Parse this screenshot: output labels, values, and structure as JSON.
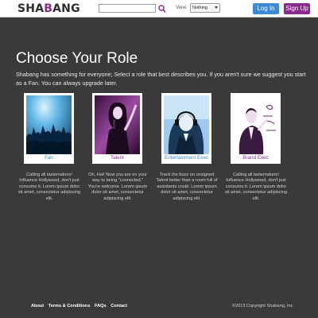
{
  "header": {
    "logo_prefix": "SHA",
    "logo_accent": "B",
    "logo_suffix": "ANG",
    "search_value": "",
    "view_label": "View:",
    "view_selected": "Nothing",
    "login_label": "Log In",
    "signup_label": "Sign Up"
  },
  "main": {
    "title": "Choose Your Role",
    "intro": "Shabang has something for everyone; Select a role that best describes you. If you aren't sure we suggest you start as a Fan. You can always upgrade later."
  },
  "roles": [
    {
      "label": "Fan",
      "description": "Calling all tastemakers! Influence Hollywood, don't just consume it. Lorem ipsum dolor sit amet, consectetur adipiscing elit."
    },
    {
      "label": "Talent",
      "description": "Oh, Hai! Now you are on your way to being \"connected.\" You're welcome. Lorem ipsum dolor sit amet, consectetur adipiscing elit."
    },
    {
      "label": "Entertainment Exec",
      "description": "Track the buzz on unsigned Talent better than a room full of assistants could. Lorem ipsum dolor sit amet, consectetur adipiscing elit."
    },
    {
      "label": "Brand Exec",
      "description": "Calling all tastemakers! Influence Hollywood, don't just consume it. Lorem ipsum dolor sit amet, consectetur adipiscing elit."
    }
  ],
  "footer": {
    "links": [
      "About",
      "Terms & Conditions",
      "FAQs",
      "Contact"
    ],
    "copyright": "©2013 Copyright Shabang, Inc."
  },
  "colors": {
    "background": "#3a3a3a",
    "brand_purple": "#8a2a8c",
    "brand_blue": "#3a8ad8"
  }
}
